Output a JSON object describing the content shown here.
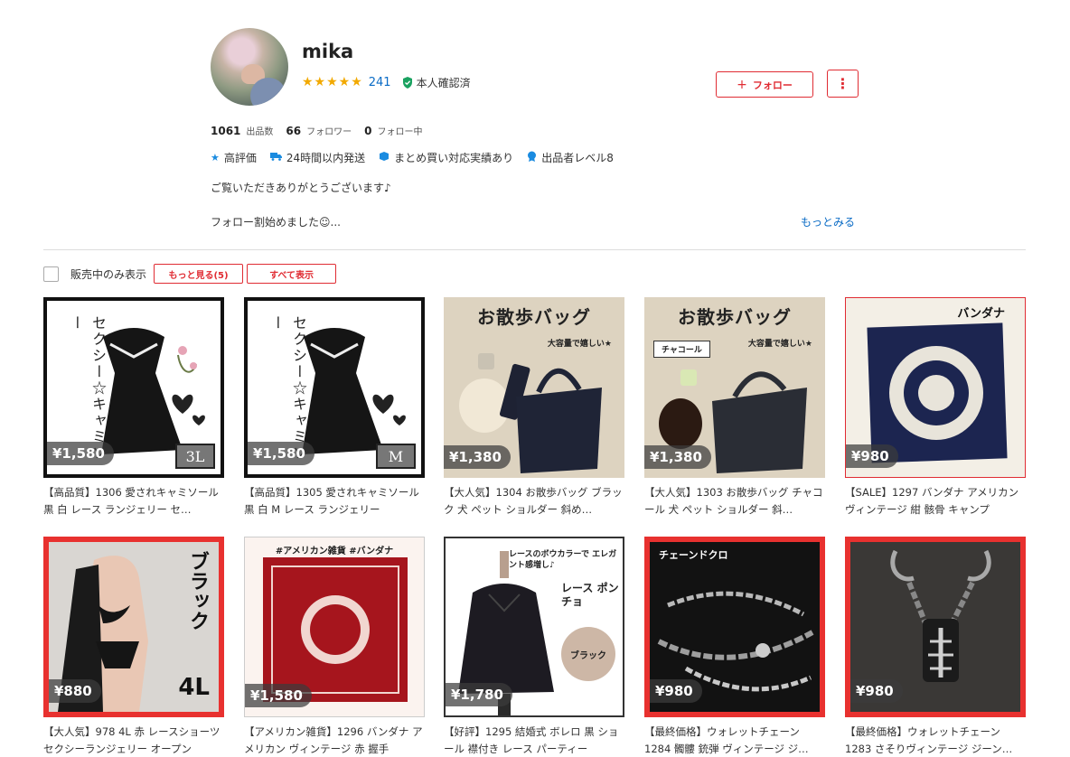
{
  "profile": {
    "name": "mika",
    "stars": "★★★★★",
    "rating_count": "241",
    "verified": "本人確認済",
    "follow_label": "フォロー",
    "follow_plus": "+",
    "more_icon": "⋮",
    "listings_count": "1061",
    "listings_label": "出品数",
    "followers_count": "66",
    "followers_label": "フォロワー",
    "following_count": "0",
    "following_label": "フォロー中",
    "badges": [
      {
        "icon": "star-icon",
        "glyph": "★",
        "label": "高評価"
      },
      {
        "icon": "truck-icon",
        "glyph": "🚚",
        "label": "24時間以内発送"
      },
      {
        "icon": "bundle-icon",
        "glyph": "■",
        "label": "まとめ買い対応実績あり"
      },
      {
        "icon": "seller-level-icon",
        "glyph": "●",
        "label": "出品者レベル8"
      }
    ],
    "intro_line1": "ご覧いただきありがとうございます♪",
    "intro_line2": "フォロー割始めました☺...",
    "more_link": "もっとみる"
  },
  "filter": {
    "on_sale_only": "販売中のみ表示",
    "see_more": "もっと見る(5)",
    "show_all": "すべて表示"
  },
  "items": [
    {
      "price": "¥1,580",
      "title": "【高品質】1306 愛されキャミソール 黒 白 レース ランジェリー セ…",
      "size": "3L",
      "vtext": "セクシー☆キャミソー"
    },
    {
      "price": "¥1,580",
      "title": "【高品質】1305 愛されキャミソール 黒 白 M レース ランジェリー",
      "size": "M",
      "vtext": "セクシー☆キャミソー"
    },
    {
      "price": "¥1,380",
      "title": "【大人気】1304 お散歩バッグ ブラック 犬 ペット ショルダー 斜め…",
      "head": "お散歩バッグ",
      "sub": "大容量で嬉しい★"
    },
    {
      "price": "¥1,380",
      "title": "【大人気】1303 お散歩バッグ チャコール 犬 ペット ショルダー 斜…",
      "head": "お散歩バッグ",
      "sub": "大容量で嬉しい★",
      "chip": "チャコール"
    },
    {
      "price": "¥980",
      "title": "【SALE】1297 バンダナ アメリカン ヴィンテージ 紺 骸骨 キャンプ",
      "label": "バンダナ"
    },
    {
      "price": "¥880",
      "title": "【大人気】978 4L 赤 レースショーツ セクシーランジェリー オープン",
      "vtext": "ブラック",
      "size": "4L"
    },
    {
      "price": "¥1,580",
      "title": "【アメリカン雑貨】1296 バンダナ アメリカン ヴィンテージ 赤 握手",
      "label": "#アメリカン雑貨 #バンダナ"
    },
    {
      "price": "¥1,780",
      "title": "【好評】1295 結婚式 ボレロ 黒 ショール 襟付き レース パーティー",
      "t1": "レースのボウカラーで エレガント感増し♪",
      "t2": "レース ポンチョ",
      "circ": "ブラック"
    },
    {
      "price": "¥980",
      "title": "【最終価格】ウォレットチェーン 1284 髑髏 銃弾 ヴィンテージ ジ…",
      "label": "チェーンドクロ"
    },
    {
      "price": "¥980",
      "title": "【最終価格】ウォレットチェーン 1283 さそりヴィンテージ ジーン…"
    }
  ]
}
